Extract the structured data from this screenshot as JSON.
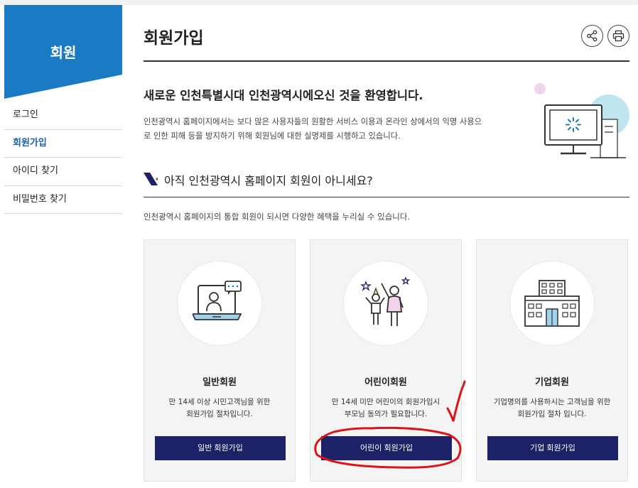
{
  "sidebar": {
    "title": "회원",
    "items": [
      {
        "label": "로그인",
        "active": false
      },
      {
        "label": "회원가입",
        "active": true
      },
      {
        "label": "아이디 찾기",
        "active": false
      },
      {
        "label": "비밀번호 찾기",
        "active": false
      }
    ]
  },
  "header": {
    "title": "회원가입",
    "share_icon": "share-icon",
    "print_icon": "print-icon"
  },
  "welcome": {
    "heading": "새로운 인천특별시대 인천광역시에오신 것을 환영합니다.",
    "line1": "인천광역시 홈페이지에서는 보다 많은 사용자들의 원활한 서비스 이용과 온라인 상에서의 익명 사용으",
    "line2": "로 인한 피해 등을 방지하기 위해 회원님에 대한 실명제를 시행하고 있습니다."
  },
  "section": {
    "title": "아직 인천광역시 홈페이지 회원이 아니세요?",
    "desc": "인천광역시 홈페이지의 통합 회원이 되시면 다양한 혜택을 누리실 수 있습니다."
  },
  "cards": [
    {
      "icon": "laptop-chat-icon",
      "title": "일반회원",
      "desc1": "만 14세 이상 시민고객님을 위한",
      "desc2": "회원가입 절차입니다.",
      "button": "일반 회원가입"
    },
    {
      "icon": "children-icon",
      "title": "어린이회원",
      "desc1": "만 14세 미만 어린이의 회원가입시",
      "desc2": "부모님 동의가 필요합니다.",
      "button": "어린이 회원가입"
    },
    {
      "icon": "building-icon",
      "title": "기업회원",
      "desc1": "기업명의를 사용하시는 고객님을 위한",
      "desc2": "회원가입 절차 입니다.",
      "button": "기업 회원가입"
    }
  ],
  "colors": {
    "sidebar_blue": "#1a7bc4",
    "button_navy": "#1d2165",
    "active_link": "#1a5fa8",
    "annotation_red": "#d9141b"
  }
}
